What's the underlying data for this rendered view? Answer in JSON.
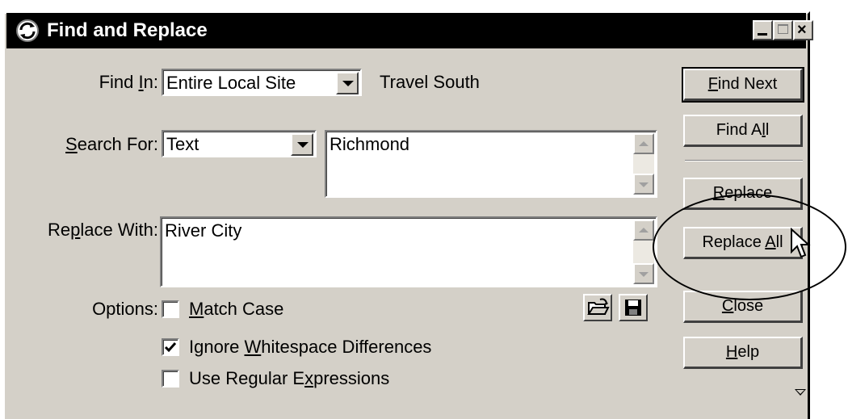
{
  "window": {
    "title": "Find and Replace",
    "controls": [
      "minimize",
      "maximize",
      "close"
    ]
  },
  "find_in": {
    "label_pre": "Find ",
    "label_key": "I",
    "label_post": "n:",
    "selected": "Entire Local Site",
    "site_name": "Travel South"
  },
  "search_for": {
    "label_key": "S",
    "label_post": "earch For:",
    "selected": "Text",
    "value": "Richmond"
  },
  "replace_with": {
    "label_pre": "Re",
    "label_key": "p",
    "label_post": "lace With:",
    "value": "River City"
  },
  "options": {
    "label": "Options:",
    "match_case": {
      "key": "M",
      "rest": "atch Case",
      "checked": false
    },
    "ignore_whitespace": {
      "pre": "Ignore ",
      "key": "W",
      "rest": "hitespace Differences",
      "checked": true
    },
    "regex": {
      "pre": "Use Regular E",
      "key": "x",
      "rest": "pressions",
      "checked": false
    }
  },
  "buttons": {
    "find_next": {
      "key": "F",
      "rest": "ind Next"
    },
    "find_all": {
      "pre": "Find A",
      "key": "l",
      "rest": "l"
    },
    "replace": {
      "key": "R",
      "rest": "eplace"
    },
    "replace_all": {
      "pre": "Replace ",
      "key": "A",
      "rest": "ll"
    },
    "close": {
      "key": "C",
      "rest": "lose"
    },
    "help": {
      "key": "H",
      "rest": "elp"
    }
  },
  "icons": {
    "app": "find-replace-icon",
    "load_query": "open-folder-icon",
    "save_query": "floppy-disk-icon",
    "expand": "triangle-down-icon",
    "pointer": "mouse-cursor-icon"
  }
}
